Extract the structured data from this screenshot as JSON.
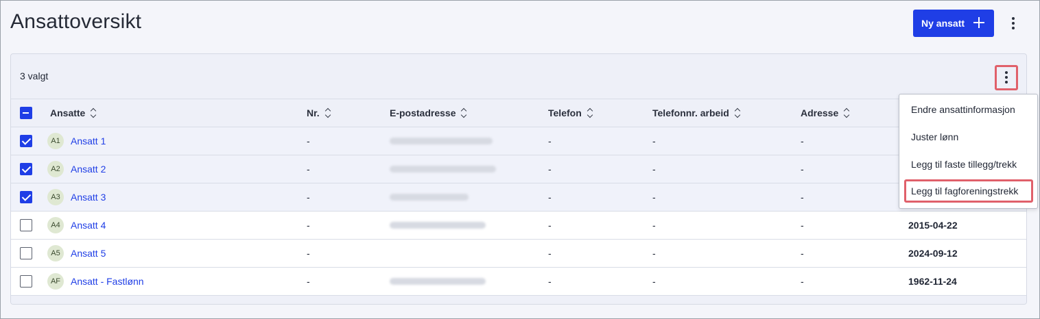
{
  "page": {
    "title": "Ansattoversikt",
    "new_button_label": "Ny ansatt"
  },
  "toolbar": {
    "selected_count": "3 valgt"
  },
  "table": {
    "columns": [
      "Ansatte",
      "Nr.",
      "E-postadresse",
      "Telefon",
      "Telefonnr. arbeid",
      "Adresse"
    ],
    "rows": [
      {
        "initials": "A1",
        "name": "Ansatt 1",
        "nr": "-",
        "phone": "-",
        "work_phone": "-",
        "address": "-",
        "date": "",
        "checked": true
      },
      {
        "initials": "A2",
        "name": "Ansatt 2",
        "nr": "-",
        "phone": "-",
        "work_phone": "-",
        "address": "-",
        "date": "",
        "checked": true
      },
      {
        "initials": "A3",
        "name": "Ansatt 3",
        "nr": "-",
        "phone": "-",
        "work_phone": "-",
        "address": "-",
        "date": "",
        "checked": true
      },
      {
        "initials": "A4",
        "name": "Ansatt 4",
        "nr": "-",
        "phone": "-",
        "work_phone": "-",
        "address": "-",
        "date": "2015-04-22",
        "checked": false
      },
      {
        "initials": "A5",
        "name": "Ansatt 5",
        "nr": "-",
        "phone": "-",
        "work_phone": "-",
        "address": "-",
        "date": "2024-09-12",
        "checked": false
      },
      {
        "initials": "AF",
        "name": "Ansatt - Fastlønn",
        "nr": "-",
        "phone": "-",
        "work_phone": "-",
        "address": "-",
        "date": "1962-11-24",
        "checked": false
      }
    ]
  },
  "menu": {
    "items": [
      "Endre ansattinformasjon",
      "Juster lønn",
      "Legg til faste tillegg/trekk",
      "Legg til fagforeningstrekk"
    ]
  },
  "colors": {
    "primary": "#1f3ee6",
    "highlight_outline": "#e0606a"
  },
  "icons": [
    "plus-icon",
    "more-vertical-icon",
    "sort-icon",
    "checkbox-icon"
  ]
}
